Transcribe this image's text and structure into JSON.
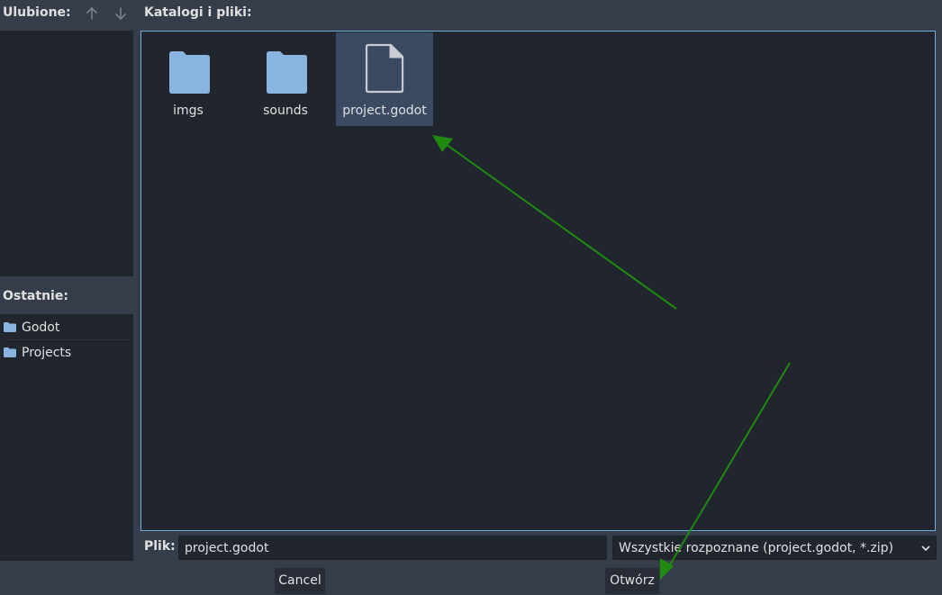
{
  "favorites": {
    "label": "Ulubione:",
    "move_up_icon": "arrow-up-icon",
    "move_down_icon": "arrow-down-icon"
  },
  "recent": {
    "label": "Ostatnie:",
    "items": [
      {
        "label": "Godot",
        "icon": "folder-icon"
      },
      {
        "label": "Projects",
        "icon": "folder-icon"
      }
    ]
  },
  "files": {
    "label": "Katalogi i pliki:",
    "items": [
      {
        "name": "imgs",
        "icon": "folder-icon",
        "selected": false
      },
      {
        "name": "sounds",
        "icon": "folder-icon",
        "selected": false
      },
      {
        "name": "project.godot",
        "icon": "file-icon",
        "selected": true
      }
    ]
  },
  "footer": {
    "file_label": "Plik:",
    "file_value": "project.godot",
    "filter_value": "Wszystkie rozpoznane (project.godot, *.zip)",
    "cancel_label": "Cancel",
    "open_label": "Otwórz"
  },
  "colors": {
    "background": "#363d4a",
    "panel": "#20252e",
    "accent_border": "#6eafd9",
    "folder": "#8ab4e0",
    "selection": "#3a4a60",
    "annotation_arrow": "#1f8a0f"
  }
}
